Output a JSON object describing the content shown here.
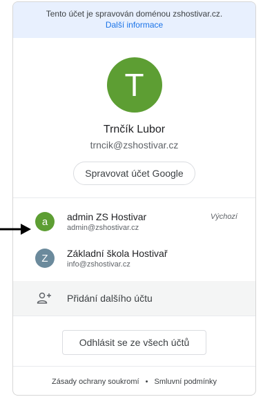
{
  "banner": {
    "managed_text": "Tento účet je spravován doménou zshostivar.cz.",
    "more_info_link": "Další informace"
  },
  "profile": {
    "avatar_letter": "T",
    "avatar_color": "#5d9e33",
    "name": "Trnčík Lubor",
    "email": "trncik@zshostivar.cz",
    "manage_button": "Spravovat účet Google"
  },
  "accounts": [
    {
      "avatar_letter": "a",
      "avatar_color": "#5d9e33",
      "name": "admin ZS Hostivar",
      "email": "admin@zshostivar.cz",
      "tag": "Výchozí"
    },
    {
      "avatar_letter": "Z",
      "avatar_color": "#6b8a9c",
      "name": "Základní škola Hostivař",
      "email": "info@zshostivar.cz"
    }
  ],
  "add_account": {
    "icon": "person-add-icon",
    "label": "Přidání dalšího účtu"
  },
  "logout": {
    "label": "Odhlásit se ze všech účtů"
  },
  "footer": {
    "privacy": "Zásady ochrany soukromí",
    "separator": "•",
    "terms": "Smluvní podmínky"
  },
  "annotation": {
    "icon": "arrow-right-icon"
  }
}
